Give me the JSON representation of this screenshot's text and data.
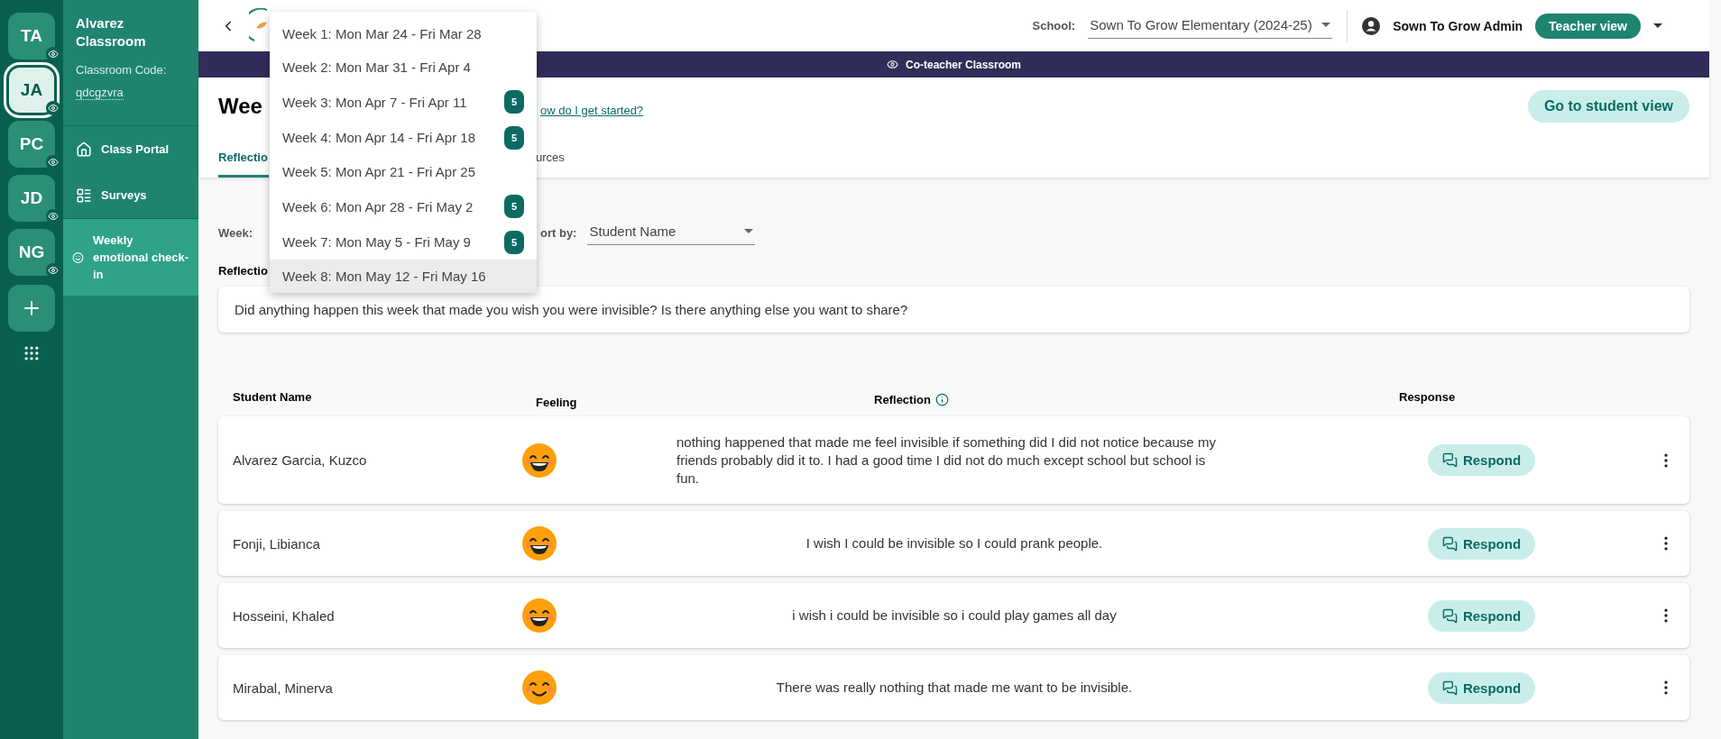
{
  "rail": {
    "classrooms": [
      {
        "initials": "TA",
        "selected": false
      },
      {
        "initials": "JA",
        "selected": true
      },
      {
        "initials": "PC",
        "selected": false
      },
      {
        "initials": "JD",
        "selected": false
      },
      {
        "initials": "NG",
        "selected": false
      }
    ]
  },
  "sidebar": {
    "classroom_name": "Alvarez Classroom",
    "code_label": "Classroom Code:",
    "code": "qdcgzvra",
    "items": [
      {
        "label": "Class Portal",
        "selected": false
      },
      {
        "label": "Surveys",
        "selected": false
      },
      {
        "label": "Weekly emotional check-in",
        "selected": true
      }
    ]
  },
  "header": {
    "school_label": "School:",
    "school": "Sown To Grow Elementary (2024-25)",
    "user": "Sown To Grow Admin",
    "view_button": "Teacher view"
  },
  "banner": "Co-teacher Classroom",
  "page": {
    "title": "Wee",
    "help_link": "ow do I get started?",
    "student_view_button": "Go to student view",
    "tabs": [
      {
        "label": "Reflectio",
        "selected": true
      },
      {
        "label": "urces",
        "selected": false
      }
    ]
  },
  "filters": {
    "week_label": "Week:",
    "sort_label": "ort by:",
    "sort_value": "Student Name"
  },
  "question_label": "Reflectio",
  "question": "Did anything happen this week that made you wish you were invisible? Is there anything else you want to share?",
  "week_menu": [
    {
      "label": "Week 1: Mon Mar 24 - Fri Mar 28",
      "selected": false
    },
    {
      "label": "Week 2: Mon Mar 31 - Fri Apr 4",
      "selected": false
    },
    {
      "label": "Week 3: Mon Apr 7 - Fri Apr 11",
      "badge": "5",
      "selected": false
    },
    {
      "label": "Week 4: Mon Apr 14 - Fri Apr 18",
      "badge": "5",
      "selected": false
    },
    {
      "label": "Week 5: Mon Apr 21 - Fri Apr 25",
      "selected": false
    },
    {
      "label": "Week 6: Mon Apr 28 - Fri May 2",
      "badge": "5",
      "selected": false
    },
    {
      "label": "Week 7: Mon May 5 - Fri May 9",
      "badge": "5",
      "selected": false
    },
    {
      "label": "Week 8: Mon May 12 - Fri May 16",
      "selected": true
    }
  ],
  "table": {
    "columns": [
      "Student Name",
      "Feeling",
      "Reflection",
      "Response"
    ],
    "rows": [
      {
        "name": "Alvarez Garcia, Kuzco",
        "kind": "grin",
        "reflection": "nothing happened that made me feel invisible if something did I did not notice because my friends probably did it to. I had a good time I did not do much except school but school is fun.",
        "action": "Respond"
      },
      {
        "name": "Fonji, Libianca",
        "kind": "grin",
        "reflection": "I wish I could be invisible so I could prank people.",
        "action": "Respond"
      },
      {
        "name": "Hosseini, Khaled",
        "kind": "grin",
        "reflection": "i wish i could be invisible so i could play games all day",
        "action": "Respond"
      },
      {
        "name": "Mirabal, Minerva",
        "kind": "smile",
        "reflection": "There was really nothing that made me want to be invisible.",
        "action": "Respond"
      }
    ]
  }
}
